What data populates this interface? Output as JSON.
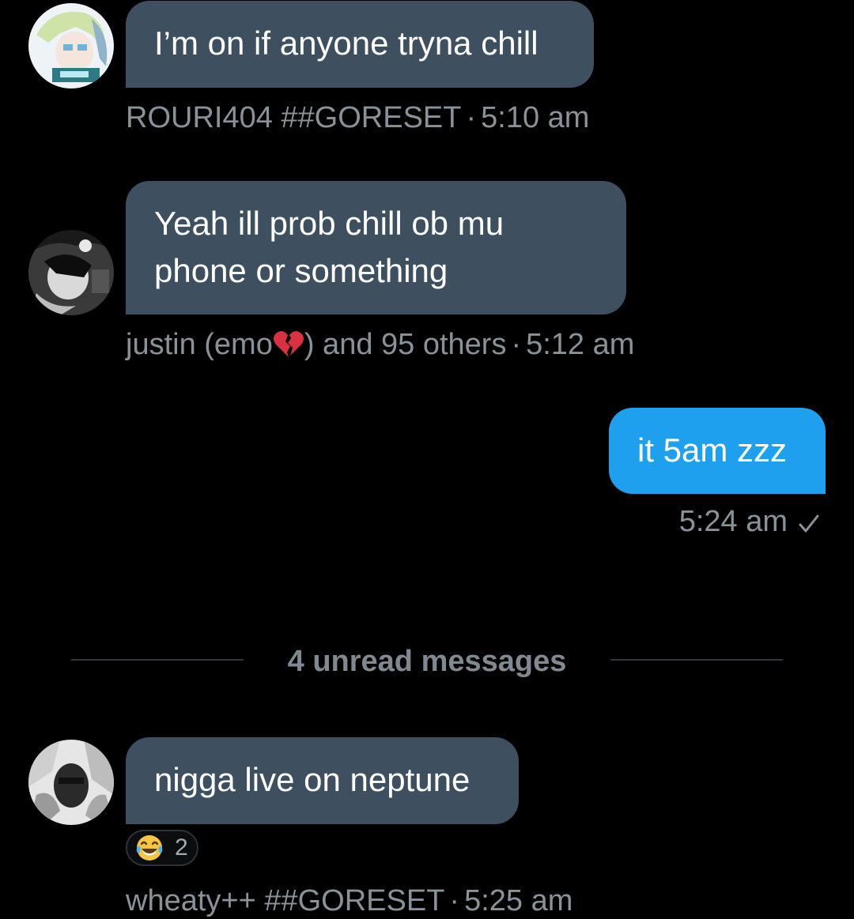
{
  "messages": [
    {
      "text": "I’m on if anyone tryna chill",
      "author": "ROURI404 ##GORESET",
      "time": "5:10 am"
    },
    {
      "text_lines": [
        "Yeah ill prob chill ob mu",
        "phone or something"
      ],
      "author_prefix": "justin (emo",
      "author_emoji": "broken-heart-icon",
      "author_suffix": ") and 95 others",
      "time": "5:12 am"
    },
    {
      "text": "it 5am zzz",
      "time": "5:24 am",
      "status_icon": "checkmark-icon"
    },
    {
      "text": "nigga live on neptune",
      "reaction": {
        "emoji": "tears-of-joy-icon",
        "count": "2"
      },
      "author": "wheaty++ ##GORESET",
      "time": "5:25 am"
    }
  ],
  "divider": {
    "label": "4 unread messages"
  },
  "colors": {
    "background": "#000000",
    "incoming_bubble": "#3e505f",
    "outgoing_bubble": "#1fa0ee",
    "meta_text": "#8a9299",
    "divider_line": "#2f353b",
    "divider_text": "#808891"
  },
  "separator": "·"
}
